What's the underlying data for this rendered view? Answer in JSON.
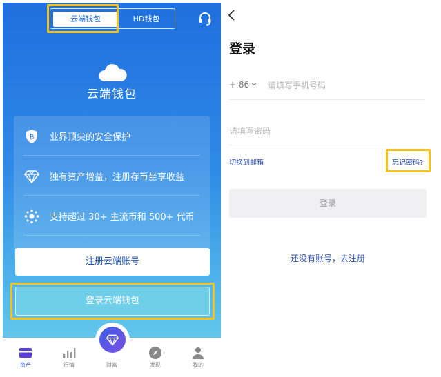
{
  "left": {
    "tabs": {
      "cloud": "云端钱包",
      "hd": "HD钱包"
    },
    "brand_title": "云端钱包",
    "features": [
      {
        "icon": "shield-icon",
        "text": "业界顶尖的安全保护"
      },
      {
        "icon": "diamond-icon",
        "text": "独有资产增益，注册存币坐享收益"
      },
      {
        "icon": "nodes-icon",
        "text": "支持超过 30+ 主流币和 500+ 代币"
      }
    ],
    "register_label": "注册云端账号",
    "login_label": "登录云端钱包",
    "nav": [
      {
        "label": "资产",
        "active": true
      },
      {
        "label": "行情",
        "active": false
      },
      {
        "label": "财富",
        "active": false
      },
      {
        "label": "发现",
        "active": false
      },
      {
        "label": "我的",
        "active": false
      }
    ],
    "colors": {
      "accent": "#1f6fdf",
      "highlight": "#f5c21b"
    }
  },
  "right": {
    "title": "登录",
    "country_code": "+ 86",
    "phone_placeholder": "请填写手机号码",
    "password_placeholder": "请填写密码",
    "switch_email": "切换到邮箱",
    "forgot_password": "忘记密码?",
    "login_button": "登录",
    "signup_link": "还没有账号，去注册",
    "colors": {
      "link": "#2d4fb0",
      "button_bg": "#f0f0f2"
    }
  }
}
